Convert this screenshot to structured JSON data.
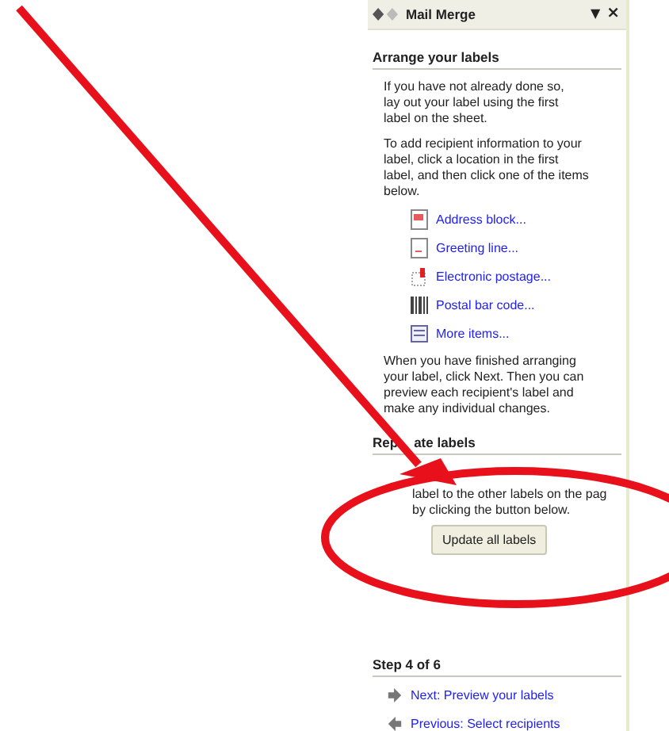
{
  "window": {
    "title": "Mail Merge",
    "menu_glyph": "▼",
    "close_glyph": "×"
  },
  "sections": [
    {
      "heading": [
        "Arrange your labels"
      ],
      "blocks": [
        {
          "kind": "para",
          "text": "If you have not already done so,\nlay out your label using the first\nlabel on the sheet."
        },
        {
          "kind": "para",
          "text": "To add recipient information to your\nlabel, click a location in the first\nlabel, and then click one of the items\nbelow."
        },
        {
          "kind": "links",
          "items": [
            {
              "label": "Address block..."
            },
            {
              "label": "Greeting line..."
            },
            {
              "label": "Electronic postage..."
            },
            {
              "label": "Postal bar code..."
            },
            {
              "label": "More items..."
            }
          ]
        },
        {
          "kind": "para",
          "text": "When you have finished arranging\nyour label, click Next. Then you can\npreview each recipient's label and\nmake any individual changes."
        }
      ]
    },
    {
      "heading": [
        "Rep",
        "ate labels"
      ],
      "blocks": [
        {
          "kind": "covered",
          "lines": [
            "label to the other labels on the pag",
            "by clicking the button below."
          ]
        },
        {
          "kind": "button",
          "label": "Update all labels"
        }
      ]
    }
  ],
  "step": {
    "title": "Step 4 of 6",
    "nav": [
      {
        "label": "Next: Preview your labels"
      },
      {
        "label": "Previous: Select recipients"
      }
    ]
  }
}
